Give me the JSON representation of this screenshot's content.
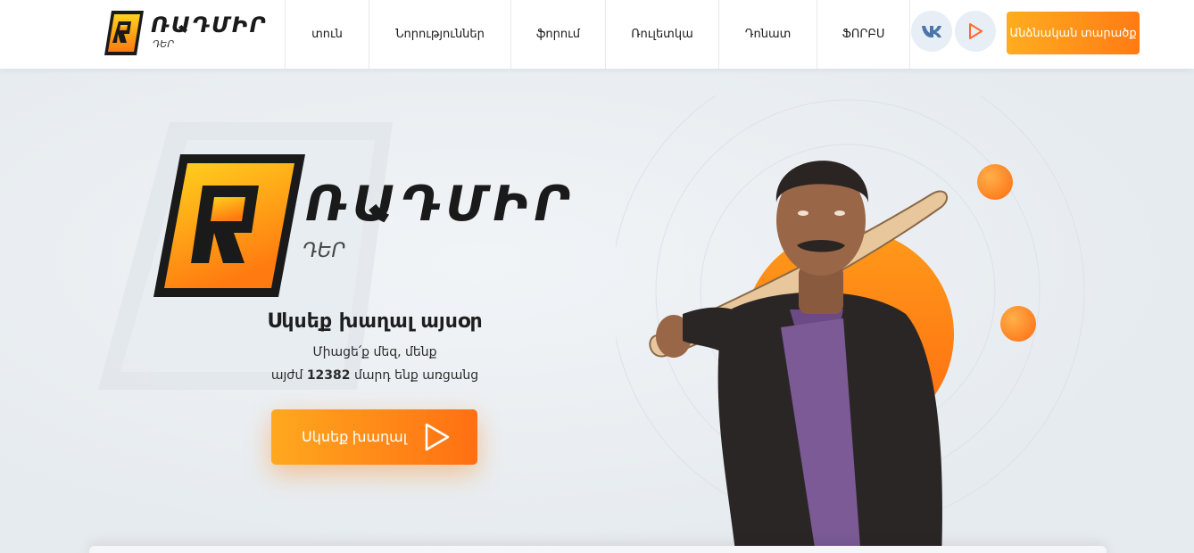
{
  "header": {
    "brand": {
      "name": "ՌԱԴՄԻՐ",
      "sub": "ԴԵՐ"
    },
    "nav": [
      {
        "label": "տուն"
      },
      {
        "label": "Նորություններ"
      },
      {
        "label": "ֆորում"
      },
      {
        "label": "Ռուլետկա"
      },
      {
        "label": "Դոնատ"
      },
      {
        "label": "ՖՈՐԲՍ"
      }
    ],
    "account_label": "Անձնական տարածք"
  },
  "hero": {
    "brand": {
      "name": "ՌԱԴՄԻՐ",
      "sub": "ԴԵՐ"
    },
    "headline": "Սկսեք խաղալ այսօր",
    "join_text": "Միացե՛ք մեզ, մենք",
    "online_prefix": "այժմ",
    "online_count": "12382",
    "online_suffix": "մարդ ենք առցանց",
    "play_label": "Սկսեք խաղալ"
  },
  "colors": {
    "accent_start": "#ffad1f",
    "accent_end": "#ff6f12",
    "background": "#e9eef2",
    "social_bg": "#e8eef5"
  },
  "icons": {
    "vk": "vk-icon",
    "play": "play-icon"
  }
}
